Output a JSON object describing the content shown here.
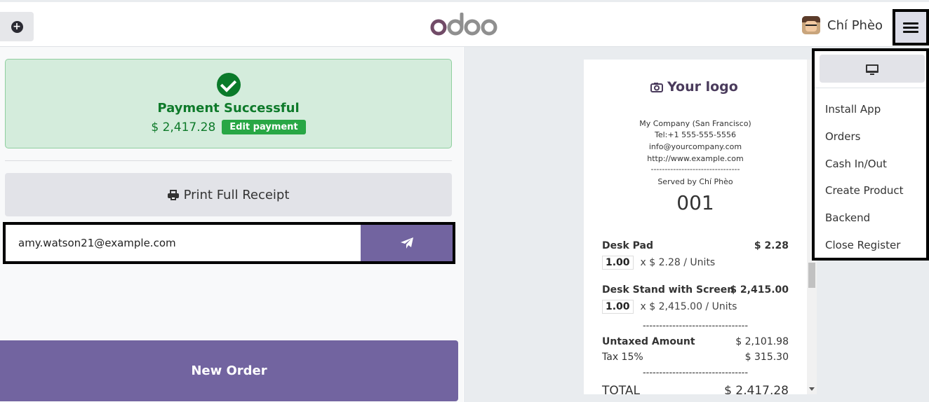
{
  "header": {
    "user_name": "Chí Phèo"
  },
  "payment": {
    "title": "Payment Successful",
    "amount": "$ 2,417.28",
    "edit_label": "Edit payment"
  },
  "actions": {
    "print_label": "Print Full Receipt",
    "email_value": "amy.watson21@example.com",
    "new_order_label": "New Order"
  },
  "receipt": {
    "logo_text": "Your logo",
    "company": "My Company (San Francisco)",
    "tel": "Tel:+1 555-555-5556",
    "email": "info@yourcompany.com",
    "website": "http://www.example.com",
    "separator": "--------------------------------",
    "served_by": "Served by Chí Phèo",
    "order_number": "001",
    "items": [
      {
        "name": "Desk Pad",
        "price": "$ 2.28",
        "qty": "1.00",
        "unit_price": "x $ 2.28 / Units"
      },
      {
        "name": "Desk Stand with Screen",
        "price": "$ 2,415.00",
        "qty": "1.00",
        "unit_price": "x $ 2,415.00 / Units"
      }
    ],
    "item_separator": "--------------------------------",
    "untaxed_label": "Untaxed Amount",
    "untaxed_value": "$ 2,101.98",
    "tax_label": "Tax 15%",
    "tax_value": "$ 315.30",
    "total_separator": "--------------------------------",
    "total_label": "TOTAL",
    "total_value": "$ 2,417.28"
  },
  "menu": {
    "items": [
      "Install App",
      "Orders",
      "Cash In/Out",
      "Create Product",
      "Backend",
      "Close Register"
    ]
  },
  "colors": {
    "brand_purple": "#7264a0",
    "success_green": "#0e7a2a",
    "success_bg": "#d4ecdc"
  }
}
